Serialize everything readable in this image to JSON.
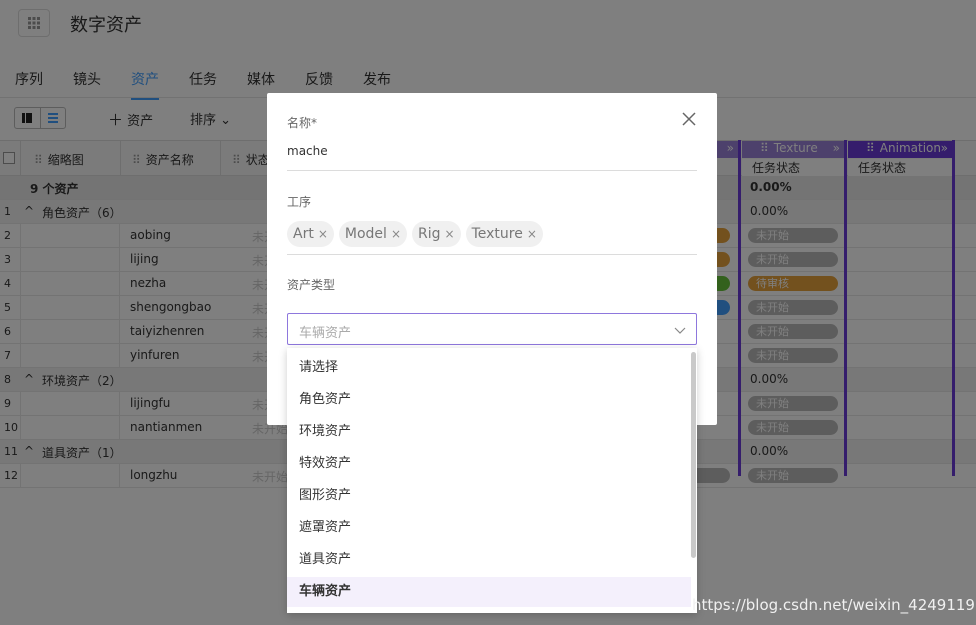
{
  "header": {
    "title": "数字资产",
    "grid_icon": "apps-grid-icon"
  },
  "tabs": [
    "序列",
    "镜头",
    "资产",
    "任务",
    "媒体",
    "反馈",
    "发布"
  ],
  "active_tab": "资产",
  "toolbar": {
    "add_label": "资产",
    "sort_label": "排序"
  },
  "table": {
    "headers": {
      "thumbnail": "缩略图",
      "name": "资产名称",
      "status": "状态"
    },
    "task_columns": [
      {
        "title": "Texture",
        "sub": "任务状态"
      },
      {
        "title": "Animation",
        "sub": "任务状态"
      }
    ],
    "summary": {
      "label": "9 个资产",
      "pct": "0.00%"
    },
    "rows": [
      {
        "num": "1",
        "type": "group",
        "label": "角色资产（6）",
        "pct": "0.00%"
      },
      {
        "num": "2",
        "type": "item",
        "name": "aobing",
        "status": "未开始",
        "texture": "未开始"
      },
      {
        "num": "3",
        "type": "item",
        "name": "lijing",
        "status": "未开始",
        "texture": "未开始"
      },
      {
        "num": "4",
        "type": "item",
        "name": "nezha",
        "status": "未开始",
        "texture": "待审核"
      },
      {
        "num": "5",
        "type": "item",
        "name": "shengongbao",
        "status": "未开始",
        "texture": "未开始"
      },
      {
        "num": "6",
        "type": "item",
        "name": "taiyizhenren",
        "status": "未开始",
        "texture": "未开始"
      },
      {
        "num": "7",
        "type": "item",
        "name": "yinfuren",
        "status": "未开始",
        "texture": "未开始"
      },
      {
        "num": "8",
        "type": "group",
        "label": "环境资产（2）",
        "pct": "0.00%"
      },
      {
        "num": "9",
        "type": "item",
        "name": "lijingfu",
        "status": "未开始",
        "texture": "未开始"
      },
      {
        "num": "10",
        "type": "item",
        "name": "nantianmen",
        "status": "未开始",
        "texture": "未开始"
      },
      {
        "num": "11",
        "type": "group",
        "label": "道具资产（1）",
        "pct": "0.00%"
      },
      {
        "num": "12",
        "type": "item",
        "name": "longzhu",
        "status": "未开始",
        "texture": "未开始"
      }
    ]
  },
  "dialog": {
    "name_label": "名称*",
    "name_value": "mache",
    "process_label": "工序",
    "process_tags": [
      "Art",
      "Model",
      "Rig",
      "Texture"
    ],
    "type_label": "资产类型",
    "type_value": "车辆资产"
  },
  "dropdown": {
    "options": [
      "请选择",
      "角色资产",
      "环境资产",
      "特效资产",
      "图形资产",
      "遮罩资产",
      "道具资产",
      "车辆资产"
    ],
    "selected": "车辆资产"
  },
  "watermark": "https://blog.csdn.net/weixin_42491193",
  "colors": {
    "accent": "#409eff",
    "purple": "#6a3bd8",
    "amber": "#e6a23c",
    "green": "#67c23a"
  }
}
